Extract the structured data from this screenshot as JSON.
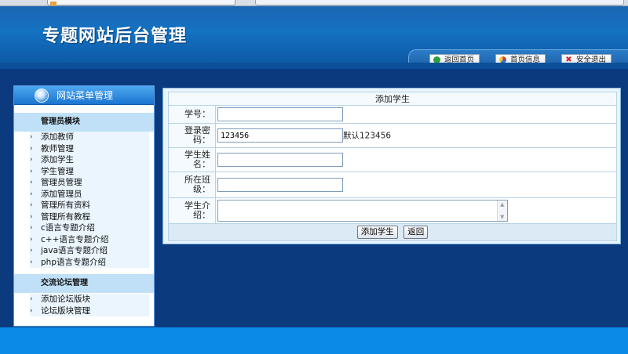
{
  "header": {
    "title": "专题网站后台管理"
  },
  "topnav": [
    {
      "label": "返回首页",
      "icon": "home-icon"
    },
    {
      "label": "首页信息",
      "icon": "pie-chart-icon"
    },
    {
      "label": "安全退出",
      "icon": "close-icon"
    }
  ],
  "sidebar": {
    "title": "网站菜单管理",
    "groups": [
      {
        "title": "管理员模块",
        "items": [
          "添加教师",
          "教师管理",
          "添加学生",
          "学生管理",
          "管理员管理",
          "添加管理员",
          "管理所有资料",
          "管理所有教程",
          "c语言专题介绍",
          "c++语言专题介绍",
          "java语言专题介绍",
          "php语言专题介绍"
        ]
      },
      {
        "title": "交流论坛管理",
        "items": [
          "添加论坛版块",
          "论坛版块管理"
        ]
      }
    ]
  },
  "form": {
    "title": "添加学生",
    "fields": {
      "student_id": {
        "label": "学号：",
        "value": ""
      },
      "password": {
        "label": "登录密码：",
        "value": "123456",
        "hint": "默认123456"
      },
      "name": {
        "label": "学生姓名：",
        "value": ""
      },
      "class": {
        "label": "所在班级：",
        "value": ""
      },
      "intro": {
        "label": "学生介绍：",
        "value": ""
      }
    },
    "submit_label": "添加学生",
    "back_label": "返回"
  },
  "colors": {
    "header_blue": "#1472c2",
    "panel_dark": "#0b3b7e",
    "bottom_blue": "#0c8ae8",
    "menu_bg": "#eaf5fd"
  }
}
